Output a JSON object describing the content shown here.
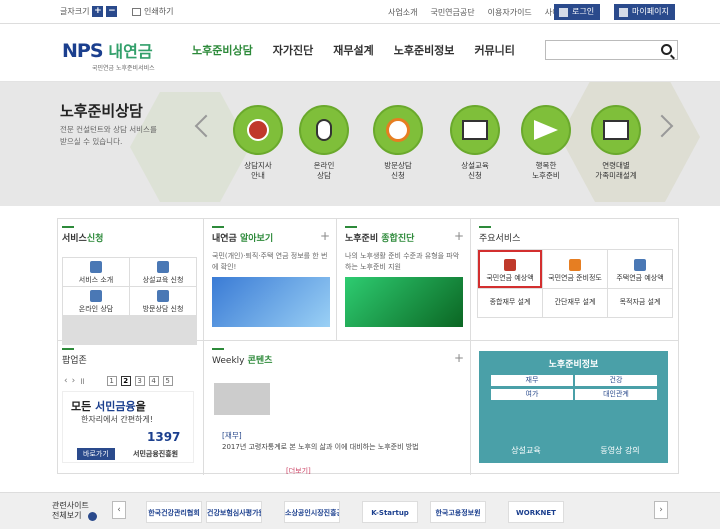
{
  "top": {
    "font_size_label": "글자크기",
    "font_up": "+",
    "font_down": "−",
    "print_label": "인쇄하기",
    "links": [
      "사업소개",
      "국민연금공단",
      "이용자가이드",
      "사이트맵"
    ],
    "login": "로그인",
    "mypage": "마이페이지"
  },
  "logo": {
    "nps": "NPS",
    "kr": "내연금",
    "sub": "국민연금 노후준비서비스"
  },
  "gnb": [
    "노후준비상담",
    "자가진단",
    "재무설계",
    "노후준비정보",
    "커뮤니티"
  ],
  "hero": {
    "title": "노후준비상담",
    "desc": "전문 컨설턴트와 상담 서비스를 받으실 수 있습니다.",
    "services": [
      {
        "label1": "상담지사",
        "label2": "안내",
        "icon": "globe-icon"
      },
      {
        "label1": "온라인",
        "label2": "상담",
        "icon": "mouse-icon"
      },
      {
        "label1": "방문상담",
        "label2": "신청",
        "icon": "clock-icon"
      },
      {
        "label1": "상설교육",
        "label2": "신청",
        "icon": "screen-icon"
      },
      {
        "label1": "행복한",
        "label2": "노후준비",
        "icon": "paper-plane-icon"
      },
      {
        "label1": "연령대별",
        "label2": "가족미래설계",
        "icon": "board-icon"
      }
    ]
  },
  "service_apply": {
    "title_a": "서비스",
    "title_b": "신청",
    "items": [
      "서비스 소개",
      "상설교육 신청",
      "온라인 상담",
      "방문상담 신청"
    ]
  },
  "pension_info": {
    "title_a": "내연금",
    "title_b": "알아보기",
    "desc": "국민(개인)·퇴직·주택 연금 정보를 한 번에 확인!"
  },
  "diagnosis": {
    "title_a": "노후준비",
    "title_b": "종합진단",
    "desc": "나의 노후생활 준비 수준과 유형을 파악하는 노후준비 지원"
  },
  "main_services": {
    "title": "주요서비스",
    "items": [
      "국민연금 예상액",
      "국민연금 준비정도",
      "주택연금 예상액",
      "종합재무 설계",
      "간단재무 설계",
      "목적자금 설계"
    ]
  },
  "popup_zone": {
    "title": "팝업존",
    "pages": [
      "1",
      "2",
      "3",
      "4",
      "5"
    ],
    "line1_a": "모든 ",
    "line1_b": "서민금융",
    "line1_c": "을",
    "line2": "한자리에서 간편하게!",
    "number": "1397",
    "go": "바로가기",
    "org": "서민금융진흥원"
  },
  "weekly": {
    "title_a": "Weekly",
    "title_b": "콘텐츠",
    "category": "[재무]",
    "text": "2017년 고령자통계로 본 노후의 삶과 이에 대비하는 노후준비 방법",
    "more": "[더보기]"
  },
  "retire_info": {
    "title": "노후준비정보",
    "buttons": [
      "재무",
      "건강",
      "여가",
      "대인관계"
    ],
    "edu": "상설교육",
    "video": "동영상 강의"
  },
  "related": {
    "label1": "관련사이트",
    "label2": "전체보기",
    "banners": [
      "한국건강관리협회",
      "건강보험심사평가원",
      "소상공인시장진흥공단",
      "K-Startup",
      "한국고용정보원",
      "WORKNET"
    ]
  }
}
